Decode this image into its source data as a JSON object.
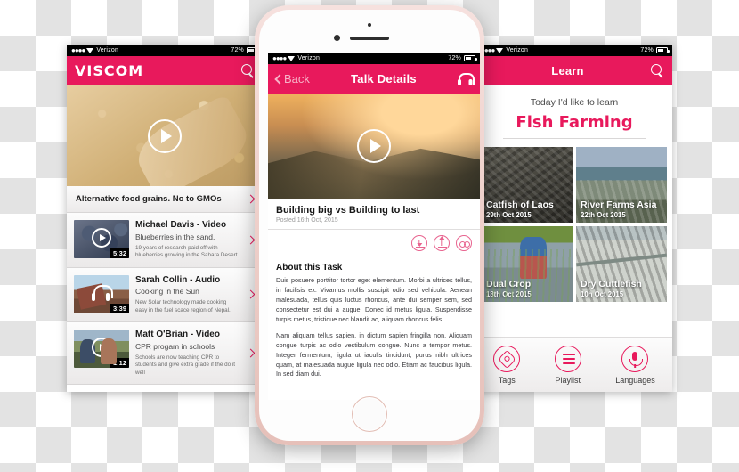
{
  "app": {
    "accent_color": "#e8195c",
    "status_bar": {
      "carrier": "Verizon",
      "battery": "72%"
    }
  },
  "left_screen": {
    "nav": {
      "brand": "VISCOM",
      "search_icon": "search-icon"
    },
    "featured": {
      "play_icon": "play-icon"
    },
    "featured_row": {
      "title": "Alternative food grains. No to GMOs",
      "chevron": "chevron-right-icon"
    },
    "items": [
      {
        "title": "Michael Davis - Video",
        "subtitle": "Blueberries in the sand.",
        "description": "19 years of research paid off with blueberries growing in the Sahara Desert",
        "duration": "5:32",
        "media_icon": "play-icon"
      },
      {
        "title": "Sarah Collin - Audio",
        "subtitle": "Cooking in the Sun",
        "description": "New Solar technology made cooking easy in the fuel scace region of Nepal.",
        "duration": "3:39",
        "media_icon": "headphones-icon"
      },
      {
        "title": "Matt O'Brian - Video",
        "subtitle": "CPR progam in schools",
        "description": "Schools are now teaching CPR to students and give extra grade if the do it well",
        "duration": "1:12",
        "media_icon": "play-icon"
      }
    ]
  },
  "center_screen": {
    "nav": {
      "back_label": "Back",
      "title": "Talk Details",
      "right_icon": "headphones-icon"
    },
    "hero": {
      "play_icon": "play-icon"
    },
    "detail": {
      "title": "Building big vs Building to last",
      "meta": "Posted 16th Oct, 2015"
    },
    "actions": [
      {
        "name": "download-button",
        "icon": "download-icon"
      },
      {
        "name": "upload-button",
        "icon": "upload-icon"
      },
      {
        "name": "read-mode-button",
        "icon": "glasses-icon"
      }
    ],
    "section_heading": "About this Task",
    "paragraphs": [
      "Duis posuere porttitor tortor eget elementum. Morbi a ultrices tellus, in facilisis ex. Vivamus mollis suscipit odio sed vehicula. Aenean malesuada, tellus quis luctus rhoncus, ante dui semper sem, sed consectetur est dui a augue. Donec id metus ligula. Suspendisse turpis metus, tristique nec blandit ac, aliquam rhoncus felis.",
      "Nam aliquam tellus sapien, in dictum sapien fringilla non. Aliquam congue turpis ac odio vestibulum congue. Nunc a tempor metus. Integer fermentum, ligula ut iaculis tincidunt, purus nibh ultrices quam, at malesuada augue ligula nec odio. Etiam ac faucibus ligula. In sed diam dui."
    ]
  },
  "right_screen": {
    "nav": {
      "title": "Learn",
      "search_icon": "search-icon"
    },
    "prompt": "Today I'd like to learn",
    "topic": "Fish Farming",
    "cards": [
      {
        "title": "Catfish of Laos",
        "date": "29th Oct 2015"
      },
      {
        "title": "River Farms Asia",
        "date": "22th Oct 2015"
      },
      {
        "title": "Dual Crop",
        "date": "18th Oct 2015"
      },
      {
        "title": "Dry Cuttlefish",
        "date": "10h Oct 2015"
      }
    ],
    "tabs": [
      {
        "label": "Tags",
        "icon": "tag-icon"
      },
      {
        "label": "Playlist",
        "icon": "list-icon"
      },
      {
        "label": "Languages",
        "icon": "microphone-icon"
      }
    ]
  }
}
